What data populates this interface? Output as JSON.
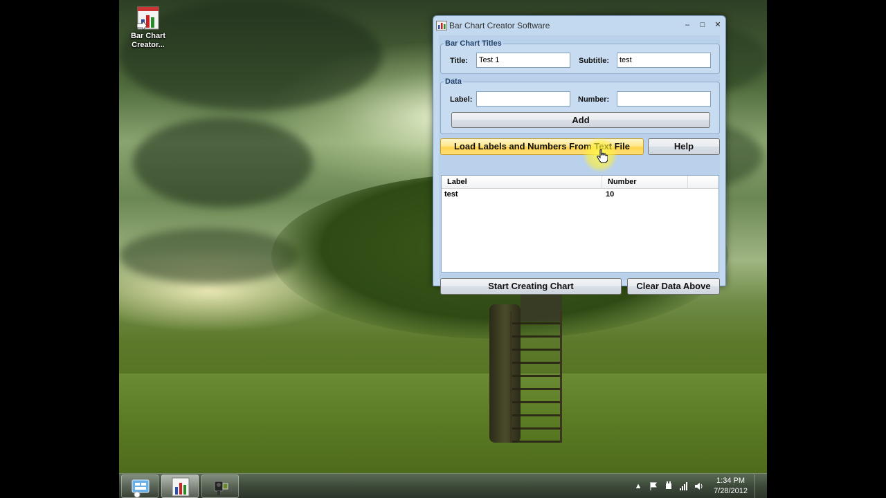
{
  "desktop": {
    "icon_label": "Bar Chart Creator..."
  },
  "window": {
    "title": "Bar Chart Creator Software",
    "minimize_glyph": "‒",
    "maximize_glyph": "□",
    "close_glyph": "✕"
  },
  "titles_group": {
    "legend": "Bar Chart Titles",
    "title_label": "Title:",
    "title_value": "Test 1",
    "subtitle_label": "Subtitle:",
    "subtitle_value": "test"
  },
  "data_group": {
    "legend": "Data",
    "label_label": "Label:",
    "label_value": "",
    "number_label": "Number:",
    "number_value": "",
    "add_button": "Add"
  },
  "buttons": {
    "load": "Load Labels and Numbers From Text File",
    "help": "Help",
    "start": "Start Creating Chart",
    "clear": "Clear Data Above"
  },
  "list": {
    "columns": [
      "Label",
      "Number"
    ],
    "rows": [
      {
        "label": "test",
        "number": "10"
      }
    ]
  },
  "taskbar": {
    "time": "1:34 PM",
    "date": "7/28/2012"
  },
  "colors": {
    "window_bg": "#c3d9ef",
    "hot_button": "#ffd44d"
  }
}
